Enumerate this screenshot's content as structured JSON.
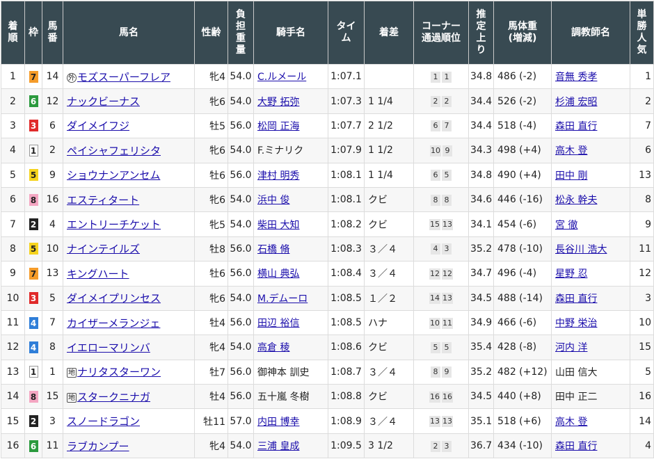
{
  "headers": {
    "finish": [
      "着",
      "順"
    ],
    "waku": "枠",
    "umaban": [
      "馬",
      "番"
    ],
    "horse": "馬名",
    "sexage": "性齢",
    "weight": [
      "負",
      "担",
      "重",
      "量"
    ],
    "jockey": "騎手名",
    "time": [
      "タ",
      "イ",
      "ム"
    ],
    "margin": "着差",
    "corner": [
      "コーナー",
      "通過順位"
    ],
    "last3f": [
      "推",
      "定",
      "上",
      "り"
    ],
    "body": [
      "馬体重",
      "(増減)"
    ],
    "trainer": "調教師名",
    "pop": [
      "単",
      "勝",
      "人",
      "気"
    ]
  },
  "waku_colors": {
    "1": {
      "bg": "#ffffff",
      "fg": "#222222",
      "border": "#999999"
    },
    "2": {
      "bg": "#222222",
      "fg": "#ffffff",
      "border": "#222222"
    },
    "3": {
      "bg": "#e02a2a",
      "fg": "#ffffff",
      "border": "#e02a2a"
    },
    "4": {
      "bg": "#2f7ed8",
      "fg": "#ffffff",
      "border": "#2f7ed8"
    },
    "5": {
      "bg": "#f5d31e",
      "fg": "#222222",
      "border": "#f5d31e"
    },
    "6": {
      "bg": "#2b9a3e",
      "fg": "#ffffff",
      "border": "#2b9a3e"
    },
    "7": {
      "bg": "#f59c2a",
      "fg": "#222222",
      "border": "#f59c2a"
    },
    "8": {
      "bg": "#f4a6c2",
      "fg": "#222222",
      "border": "#f4a6c2"
    }
  },
  "rows": [
    {
      "finish": "1",
      "waku": "7",
      "umaban": "14",
      "tag": "外",
      "horse": "モズスーパーフレア",
      "sexage": "牝4",
      "weight": "54.0",
      "jockey": "C.ルメール",
      "jockey_link": true,
      "time": "1:07.1",
      "margin": "",
      "corner": [
        "1",
        "1"
      ],
      "last3f": "34.8",
      "body": "486 (-2)",
      "trainer": "音無 秀孝",
      "trainer_link": true,
      "pop": "1"
    },
    {
      "finish": "2",
      "waku": "6",
      "umaban": "12",
      "tag": "",
      "horse": "ナックビーナス",
      "sexage": "牝6",
      "weight": "54.0",
      "jockey": "大野 拓弥",
      "jockey_link": true,
      "time": "1:07.3",
      "margin": "1 1/4",
      "corner": [
        "2",
        "2"
      ],
      "last3f": "34.4",
      "body": "526 (-2)",
      "trainer": "杉浦 宏昭",
      "trainer_link": true,
      "pop": "2"
    },
    {
      "finish": "3",
      "waku": "3",
      "umaban": "6",
      "tag": "",
      "horse": "ダイメイフジ",
      "sexage": "牡5",
      "weight": "56.0",
      "jockey": "松岡 正海",
      "jockey_link": true,
      "time": "1:07.7",
      "margin": "2 1/2",
      "corner": [
        "6",
        "7"
      ],
      "last3f": "34.4",
      "body": "518 (-4)",
      "trainer": "森田 直行",
      "trainer_link": true,
      "pop": "7"
    },
    {
      "finish": "4",
      "waku": "1",
      "umaban": "2",
      "tag": "",
      "horse": "ペイシャフェリシタ",
      "sexage": "牝6",
      "weight": "54.0",
      "jockey": "F.ミナリク",
      "jockey_link": false,
      "time": "1:07.9",
      "margin": "1 1/2",
      "corner": [
        "10",
        "9"
      ],
      "last3f": "34.3",
      "body": "498 (+4)",
      "trainer": "高木 登",
      "trainer_link": true,
      "pop": "6"
    },
    {
      "finish": "5",
      "waku": "5",
      "umaban": "9",
      "tag": "",
      "horse": "ショウナンアンセム",
      "sexage": "牡6",
      "weight": "56.0",
      "jockey": "津村 明秀",
      "jockey_link": true,
      "time": "1:08.1",
      "margin": "1 1/4",
      "corner": [
        "6",
        "5"
      ],
      "last3f": "34.8",
      "body": "490 (+4)",
      "trainer": "田中 剛",
      "trainer_link": true,
      "pop": "13"
    },
    {
      "finish": "6",
      "waku": "8",
      "umaban": "16",
      "tag": "",
      "horse": "エスティタート",
      "sexage": "牝6",
      "weight": "54.0",
      "jockey": "浜中 俊",
      "jockey_link": true,
      "time": "1:08.1",
      "margin": "クビ",
      "corner": [
        "8",
        "8"
      ],
      "last3f": "34.6",
      "body": "446 (-16)",
      "trainer": "松永 幹夫",
      "trainer_link": true,
      "pop": "8"
    },
    {
      "finish": "7",
      "waku": "2",
      "umaban": "4",
      "tag": "",
      "horse": "エントリーチケット",
      "sexage": "牝5",
      "weight": "54.0",
      "jockey": "柴田 大知",
      "jockey_link": true,
      "time": "1:08.2",
      "margin": "クビ",
      "corner": [
        "15",
        "13"
      ],
      "last3f": "34.1",
      "body": "454 (-6)",
      "trainer": "宮 徹",
      "trainer_link": true,
      "pop": "9"
    },
    {
      "finish": "8",
      "waku": "5",
      "umaban": "10",
      "tag": "",
      "horse": "ナインテイルズ",
      "sexage": "牡8",
      "weight": "56.0",
      "jockey": "石橋 脩",
      "jockey_link": true,
      "time": "1:08.3",
      "margin": "３／４",
      "corner": [
        "4",
        "3"
      ],
      "last3f": "35.2",
      "body": "478 (-10)",
      "trainer": "長谷川 浩大",
      "trainer_link": true,
      "pop": "11"
    },
    {
      "finish": "9",
      "waku": "7",
      "umaban": "13",
      "tag": "",
      "horse": "キングハート",
      "sexage": "牡6",
      "weight": "56.0",
      "jockey": "横山 典弘",
      "jockey_link": true,
      "time": "1:08.4",
      "margin": "３／４",
      "corner": [
        "12",
        "12"
      ],
      "last3f": "34.7",
      "body": "496 (-4)",
      "trainer": "星野 忍",
      "trainer_link": true,
      "pop": "12"
    },
    {
      "finish": "10",
      "waku": "3",
      "umaban": "5",
      "tag": "",
      "horse": "ダイメイプリンセス",
      "sexage": "牝6",
      "weight": "54.0",
      "jockey": "M.デムーロ",
      "jockey_link": true,
      "time": "1:08.5",
      "margin": "１／２",
      "corner": [
        "14",
        "13"
      ],
      "last3f": "34.5",
      "body": "488 (-14)",
      "trainer": "森田 直行",
      "trainer_link": true,
      "pop": "3"
    },
    {
      "finish": "11",
      "waku": "4",
      "umaban": "7",
      "tag": "",
      "horse": "カイザーメランジェ",
      "sexage": "牡4",
      "weight": "56.0",
      "jockey": "田辺 裕信",
      "jockey_link": true,
      "time": "1:08.5",
      "margin": "ハナ",
      "corner": [
        "10",
        "11"
      ],
      "last3f": "34.9",
      "body": "466 (-6)",
      "trainer": "中野 栄治",
      "trainer_link": true,
      "pop": "10"
    },
    {
      "finish": "12",
      "waku": "4",
      "umaban": "8",
      "tag": "",
      "horse": "イエローマリンバ",
      "sexage": "牝4",
      "weight": "54.0",
      "jockey": "高倉 稜",
      "jockey_link": true,
      "time": "1:08.6",
      "margin": "クビ",
      "corner": [
        "5",
        "5"
      ],
      "last3f": "35.4",
      "body": "428 (-8)",
      "trainer": "河内 洋",
      "trainer_link": true,
      "pop": "15"
    },
    {
      "finish": "13",
      "waku": "1",
      "umaban": "1",
      "tag": "地",
      "horse": "ナリタスターワン",
      "sexage": "牡7",
      "weight": "56.0",
      "jockey": "御神本 訓史",
      "jockey_link": false,
      "time": "1:08.7",
      "margin": "３／４",
      "corner": [
        "8",
        "9"
      ],
      "last3f": "35.2",
      "body": "482 (+12)",
      "trainer": "山田 信大",
      "trainer_link": false,
      "pop": "5"
    },
    {
      "finish": "14",
      "waku": "8",
      "umaban": "15",
      "tag": "地",
      "horse": "スタークニナガ",
      "sexage": "牡4",
      "weight": "56.0",
      "jockey": "五十嵐 冬樹",
      "jockey_link": false,
      "time": "1:08.8",
      "margin": "クビ",
      "corner": [
        "16",
        "16"
      ],
      "last3f": "34.5",
      "body": "440 (+8)",
      "trainer": "田中 正二",
      "trainer_link": false,
      "pop": "16"
    },
    {
      "finish": "15",
      "waku": "2",
      "umaban": "3",
      "tag": "",
      "horse": "スノードラゴン",
      "sexage": "牡11",
      "weight": "57.0",
      "jockey": "内田 博幸",
      "jockey_link": true,
      "time": "1:08.9",
      "margin": "３／４",
      "corner": [
        "13",
        "13"
      ],
      "last3f": "35.1",
      "body": "518 (+6)",
      "trainer": "高木 登",
      "trainer_link": true,
      "pop": "14"
    },
    {
      "finish": "16",
      "waku": "6",
      "umaban": "11",
      "tag": "",
      "horse": "ラブカンプー",
      "sexage": "牝4",
      "weight": "54.0",
      "jockey": "三浦 皇成",
      "jockey_link": true,
      "time": "1:09.5",
      "margin": "3 1/2",
      "corner": [
        "2",
        "3"
      ],
      "last3f": "36.7",
      "body": "434 (-10)",
      "trainer": "森田 直行",
      "trainer_link": true,
      "pop": "4"
    }
  ]
}
